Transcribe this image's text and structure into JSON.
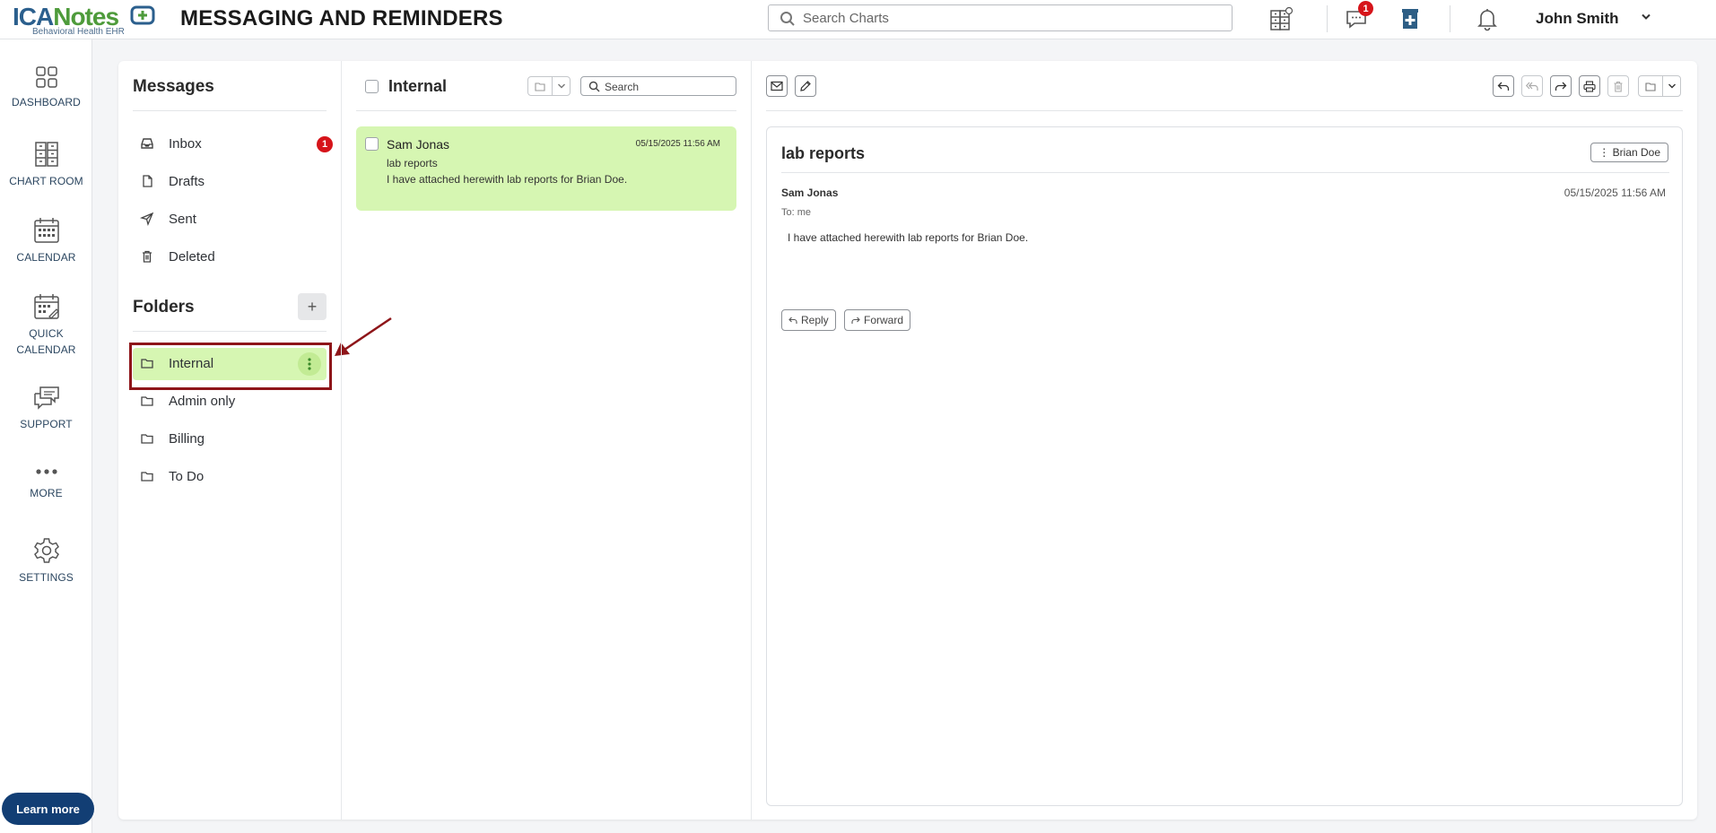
{
  "app": {
    "logo_brand_1": "ICA",
    "logo_brand_2": "Notes",
    "logo_tagline": "Behavioral Health EHR",
    "page_title": "MESSAGING AND REMINDERS"
  },
  "topbar": {
    "search_placeholder": "Search Charts",
    "messages_badge": "1",
    "user_name": "John Smith"
  },
  "nav": [
    {
      "label": "DASHBOARD",
      "icon": "dashboard-icon"
    },
    {
      "label": "CHART ROOM",
      "icon": "chart-room-icon"
    },
    {
      "label": "CALENDAR",
      "icon": "calendar-icon"
    },
    {
      "label_line1": "QUICK",
      "label_line2": "CALENDAR",
      "icon": "quick-calendar-icon"
    },
    {
      "label": "SUPPORT",
      "icon": "support-icon"
    },
    {
      "label": "MORE",
      "icon": "more-icon"
    },
    {
      "label": "SETTINGS",
      "icon": "settings-icon"
    }
  ],
  "learn_more": "Learn more",
  "messages": {
    "heading": "Messages",
    "items": [
      {
        "label": "Inbox",
        "badge": "1",
        "icon": "inbox-icon"
      },
      {
        "label": "Drafts",
        "icon": "draft-icon"
      },
      {
        "label": "Sent",
        "icon": "send-icon"
      },
      {
        "label": "Deleted",
        "icon": "trash-icon"
      }
    ]
  },
  "folders": {
    "heading": "Folders",
    "add_label": "+",
    "items": [
      {
        "label": "Internal",
        "active": true
      },
      {
        "label": "Admin only"
      },
      {
        "label": "Billing"
      },
      {
        "label": "To Do"
      }
    ]
  },
  "list": {
    "title": "Internal",
    "search_placeholder": "Search",
    "messages": [
      {
        "sender": "Sam Jonas",
        "date": "05/15/2025 11:56 AM",
        "subject": "lab reports",
        "preview": "I have attached herewith lab reports for Brian Doe."
      }
    ]
  },
  "detail": {
    "subject": "lab reports",
    "patient_tag": "⋮ Brian Doe",
    "from": "Sam Jonas",
    "date": "05/15/2025 11:56 AM",
    "to": "To: me",
    "body": "I have attached herewith lab reports for Brian Doe.",
    "reply_label": "Reply",
    "forward_label": "Forward"
  },
  "colors": {
    "accent_green": "#d6f6b2",
    "badge_red": "#d6141a",
    "highlight_border": "#8e1519",
    "learn_more_bg": "#123e74"
  }
}
